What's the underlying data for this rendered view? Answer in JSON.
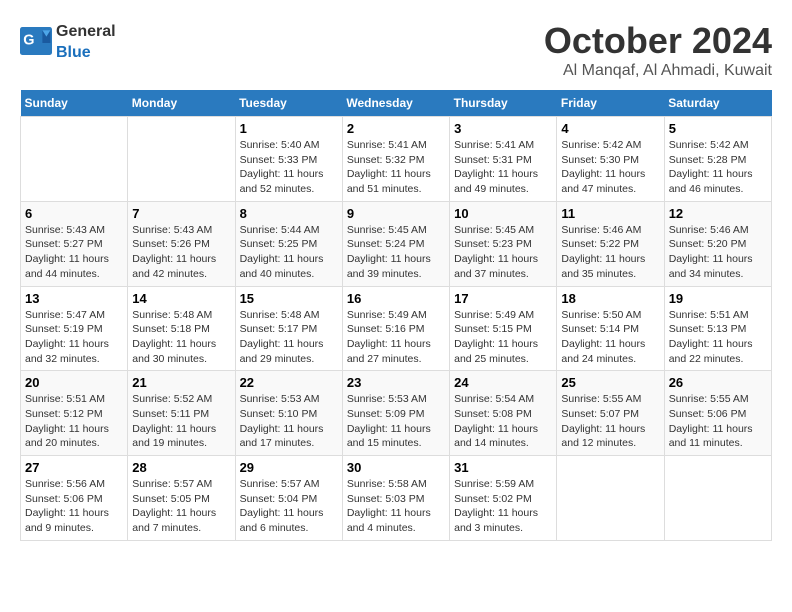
{
  "header": {
    "logo_general": "General",
    "logo_blue": "Blue",
    "month_title": "October 2024",
    "location": "Al Manqaf, Al Ahmadi, Kuwait"
  },
  "days_of_week": [
    "Sunday",
    "Monday",
    "Tuesday",
    "Wednesday",
    "Thursday",
    "Friday",
    "Saturday"
  ],
  "weeks": [
    [
      {
        "day": "",
        "content": ""
      },
      {
        "day": "",
        "content": ""
      },
      {
        "day": "1",
        "content": "Sunrise: 5:40 AM\nSunset: 5:33 PM\nDaylight: 11 hours and 52 minutes."
      },
      {
        "day": "2",
        "content": "Sunrise: 5:41 AM\nSunset: 5:32 PM\nDaylight: 11 hours and 51 minutes."
      },
      {
        "day": "3",
        "content": "Sunrise: 5:41 AM\nSunset: 5:31 PM\nDaylight: 11 hours and 49 minutes."
      },
      {
        "day": "4",
        "content": "Sunrise: 5:42 AM\nSunset: 5:30 PM\nDaylight: 11 hours and 47 minutes."
      },
      {
        "day": "5",
        "content": "Sunrise: 5:42 AM\nSunset: 5:28 PM\nDaylight: 11 hours and 46 minutes."
      }
    ],
    [
      {
        "day": "6",
        "content": "Sunrise: 5:43 AM\nSunset: 5:27 PM\nDaylight: 11 hours and 44 minutes."
      },
      {
        "day": "7",
        "content": "Sunrise: 5:43 AM\nSunset: 5:26 PM\nDaylight: 11 hours and 42 minutes."
      },
      {
        "day": "8",
        "content": "Sunrise: 5:44 AM\nSunset: 5:25 PM\nDaylight: 11 hours and 40 minutes."
      },
      {
        "day": "9",
        "content": "Sunrise: 5:45 AM\nSunset: 5:24 PM\nDaylight: 11 hours and 39 minutes."
      },
      {
        "day": "10",
        "content": "Sunrise: 5:45 AM\nSunset: 5:23 PM\nDaylight: 11 hours and 37 minutes."
      },
      {
        "day": "11",
        "content": "Sunrise: 5:46 AM\nSunset: 5:22 PM\nDaylight: 11 hours and 35 minutes."
      },
      {
        "day": "12",
        "content": "Sunrise: 5:46 AM\nSunset: 5:20 PM\nDaylight: 11 hours and 34 minutes."
      }
    ],
    [
      {
        "day": "13",
        "content": "Sunrise: 5:47 AM\nSunset: 5:19 PM\nDaylight: 11 hours and 32 minutes."
      },
      {
        "day": "14",
        "content": "Sunrise: 5:48 AM\nSunset: 5:18 PM\nDaylight: 11 hours and 30 minutes."
      },
      {
        "day": "15",
        "content": "Sunrise: 5:48 AM\nSunset: 5:17 PM\nDaylight: 11 hours and 29 minutes."
      },
      {
        "day": "16",
        "content": "Sunrise: 5:49 AM\nSunset: 5:16 PM\nDaylight: 11 hours and 27 minutes."
      },
      {
        "day": "17",
        "content": "Sunrise: 5:49 AM\nSunset: 5:15 PM\nDaylight: 11 hours and 25 minutes."
      },
      {
        "day": "18",
        "content": "Sunrise: 5:50 AM\nSunset: 5:14 PM\nDaylight: 11 hours and 24 minutes."
      },
      {
        "day": "19",
        "content": "Sunrise: 5:51 AM\nSunset: 5:13 PM\nDaylight: 11 hours and 22 minutes."
      }
    ],
    [
      {
        "day": "20",
        "content": "Sunrise: 5:51 AM\nSunset: 5:12 PM\nDaylight: 11 hours and 20 minutes."
      },
      {
        "day": "21",
        "content": "Sunrise: 5:52 AM\nSunset: 5:11 PM\nDaylight: 11 hours and 19 minutes."
      },
      {
        "day": "22",
        "content": "Sunrise: 5:53 AM\nSunset: 5:10 PM\nDaylight: 11 hours and 17 minutes."
      },
      {
        "day": "23",
        "content": "Sunrise: 5:53 AM\nSunset: 5:09 PM\nDaylight: 11 hours and 15 minutes."
      },
      {
        "day": "24",
        "content": "Sunrise: 5:54 AM\nSunset: 5:08 PM\nDaylight: 11 hours and 14 minutes."
      },
      {
        "day": "25",
        "content": "Sunrise: 5:55 AM\nSunset: 5:07 PM\nDaylight: 11 hours and 12 minutes."
      },
      {
        "day": "26",
        "content": "Sunrise: 5:55 AM\nSunset: 5:06 PM\nDaylight: 11 hours and 11 minutes."
      }
    ],
    [
      {
        "day": "27",
        "content": "Sunrise: 5:56 AM\nSunset: 5:06 PM\nDaylight: 11 hours and 9 minutes."
      },
      {
        "day": "28",
        "content": "Sunrise: 5:57 AM\nSunset: 5:05 PM\nDaylight: 11 hours and 7 minutes."
      },
      {
        "day": "29",
        "content": "Sunrise: 5:57 AM\nSunset: 5:04 PM\nDaylight: 11 hours and 6 minutes."
      },
      {
        "day": "30",
        "content": "Sunrise: 5:58 AM\nSunset: 5:03 PM\nDaylight: 11 hours and 4 minutes."
      },
      {
        "day": "31",
        "content": "Sunrise: 5:59 AM\nSunset: 5:02 PM\nDaylight: 11 hours and 3 minutes."
      },
      {
        "day": "",
        "content": ""
      },
      {
        "day": "",
        "content": ""
      }
    ]
  ]
}
